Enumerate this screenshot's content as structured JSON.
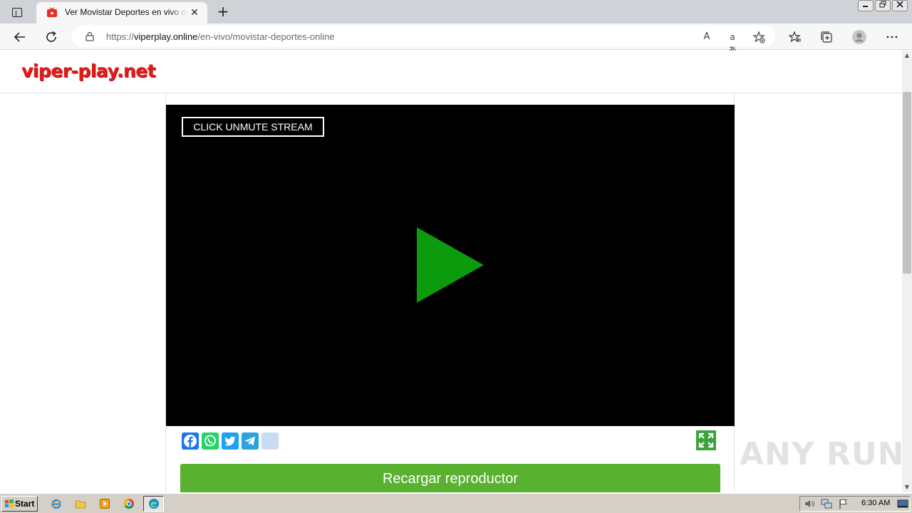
{
  "browser": {
    "tab_title": "Ver Movistar Deportes en vivo online",
    "tab_close": "✕",
    "new_tab": "+",
    "url_scheme": "https://",
    "url_host": "viperplay.online",
    "url_path": "/en-vivo/movistar-deportes-online",
    "read_aloud_icon": "A",
    "translate_icon": "aあ"
  },
  "site": {
    "logo": "viper-play.net",
    "unmute_label": "CLICK UNMUTE STREAM",
    "reload_label": "Recargar reproductor",
    "colors": {
      "logo": "#e01b1b",
      "play": "#0c9b0c",
      "reload": "#58b22f"
    }
  },
  "share": [
    {
      "name": "facebook",
      "color": "#1877f2"
    },
    {
      "name": "whatsapp",
      "color": "#25d366"
    },
    {
      "name": "twitter",
      "color": "#1da1f2"
    },
    {
      "name": "telegram",
      "color": "#2aa3df"
    },
    {
      "name": "share",
      "color": "#c9dcf6"
    }
  ],
  "watermark": "ANY RUN",
  "taskbar": {
    "start_label": "Start",
    "clock": "6:30 AM"
  }
}
